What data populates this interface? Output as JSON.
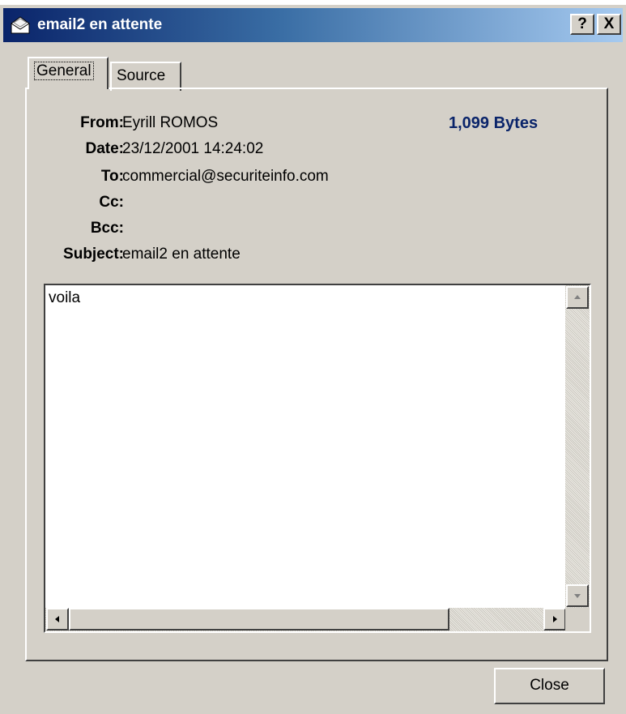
{
  "window": {
    "title": "email2 en attente",
    "title_icon": "envelope-icon",
    "help_label": "?",
    "close_label": "X"
  },
  "tabs": [
    {
      "label": "General",
      "active": true
    },
    {
      "label": "Source",
      "active": false
    }
  ],
  "headers": {
    "from_label": "From:",
    "from_value": "Eyrill ROMOS",
    "date_label": "Date:",
    "date_value": "23/12/2001 14:24:02",
    "to_label": "To:",
    "to_value": "commercial@securiteinfo.com",
    "cc_label": "Cc:",
    "cc_value": "",
    "bcc_label": "Bcc:",
    "bcc_value": "",
    "subject_label": "Subject:",
    "subject_value": "email2 en attente"
  },
  "size": "1,099 Bytes",
  "body": {
    "text": "voila"
  },
  "footer": {
    "close_label": "Close"
  },
  "colors": {
    "title_start": "#0a246a",
    "title_end": "#a6caf0",
    "size_text": "#0a246a",
    "face": "#d4d0c8"
  }
}
